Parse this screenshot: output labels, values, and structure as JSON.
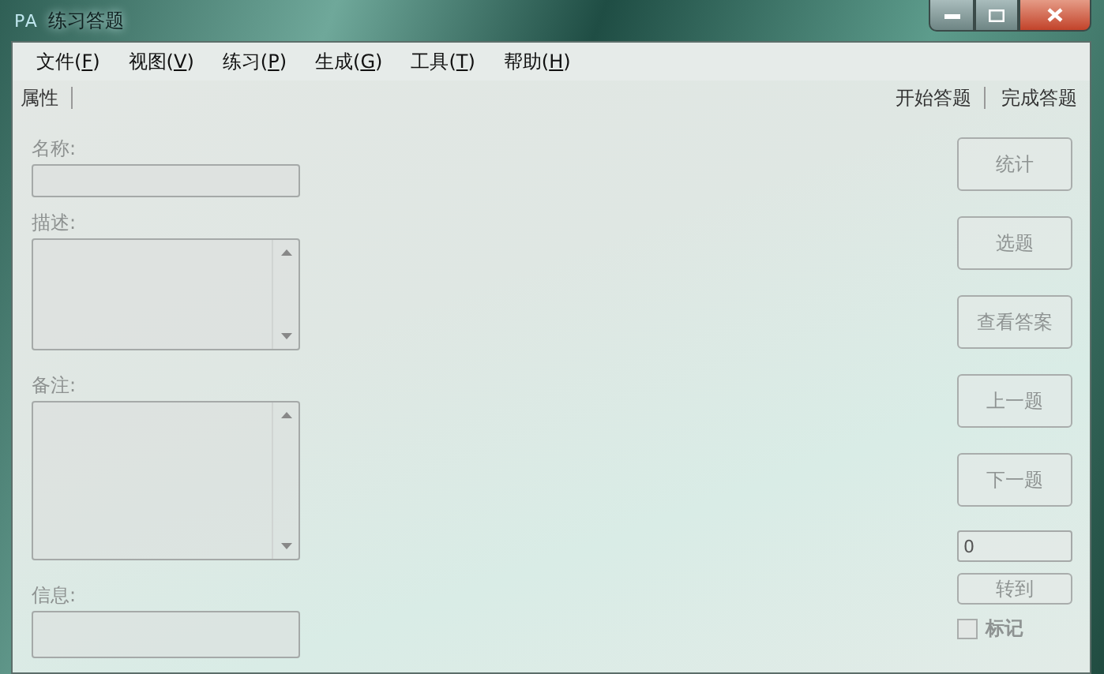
{
  "window": {
    "icon_text": "PA",
    "title": "练习答题"
  },
  "menu": [
    {
      "before": "文件(",
      "mnemonic": "F",
      "after": ")"
    },
    {
      "before": "视图(",
      "mnemonic": "V",
      "after": ")"
    },
    {
      "before": "练习(",
      "mnemonic": "P",
      "after": ")"
    },
    {
      "before": "生成(",
      "mnemonic": "G",
      "after": ")"
    },
    {
      "before": "工具(",
      "mnemonic": "T",
      "after": ")"
    },
    {
      "before": "帮助(",
      "mnemonic": "H",
      "after": ")"
    }
  ],
  "toolbar": {
    "left": [
      "属性"
    ],
    "right": [
      "开始答题",
      "完成答题"
    ]
  },
  "fields": [
    {
      "label": "名称:",
      "kind": "input"
    },
    {
      "label": "描述:",
      "kind": "textarea"
    },
    {
      "label": "备注:",
      "kind": "textarea"
    },
    {
      "label": "信息:",
      "kind": "input"
    }
  ],
  "buttons": [
    {
      "label": "统计",
      "disabled": true
    },
    {
      "label": "选题",
      "disabled": true
    },
    {
      "label": "查看答案",
      "disabled": true
    },
    {
      "label": "上一题",
      "disabled": true
    },
    {
      "label": "下一题",
      "disabled": true
    }
  ],
  "goto": {
    "value": "0",
    "button": {
      "label": "转到",
      "disabled": true
    }
  },
  "mark": {
    "label": "标记",
    "checked": false,
    "disabled": true
  }
}
